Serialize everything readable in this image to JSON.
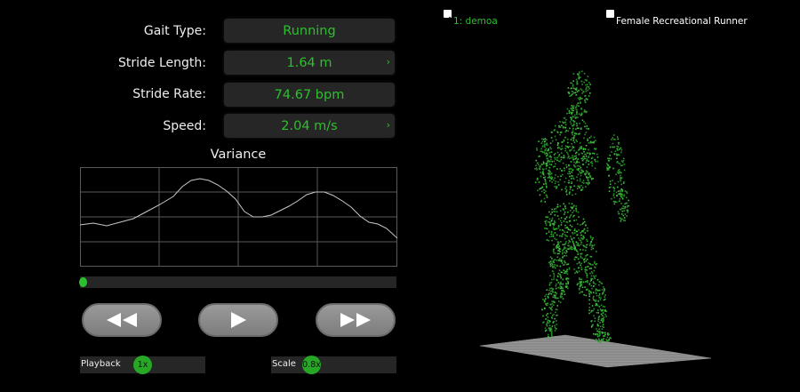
{
  "fields": [
    {
      "label": "Gait Type:",
      "value": "Running",
      "chevron": false
    },
    {
      "label": "Stride Length:",
      "value": "1.64 m",
      "chevron": true
    },
    {
      "label": "Stride Rate:",
      "value": "74.67 bpm",
      "chevron": false
    },
    {
      "label": "Speed:",
      "value": "2.04 m/s",
      "chevron": true
    }
  ],
  "chevron_glyph": "›",
  "variance_title": "Variance",
  "controls": {
    "rewind_icon": "fast-rewind-icon",
    "play_icon": "play-icon",
    "forward_icon": "fast-forward-icon"
  },
  "playback": {
    "label": "Playback",
    "value": "1x"
  },
  "scale": {
    "label": "Scale",
    "value": "0.8x"
  },
  "seek_progress": 0,
  "legend": {
    "primary": {
      "label": "1: demoa",
      "checked": true,
      "color": "#2cc02c"
    },
    "secondary": {
      "label": "Female Recreational Runner",
      "checked": false,
      "color": "#ffffff"
    }
  },
  "accent_color": "#2cc02c"
}
